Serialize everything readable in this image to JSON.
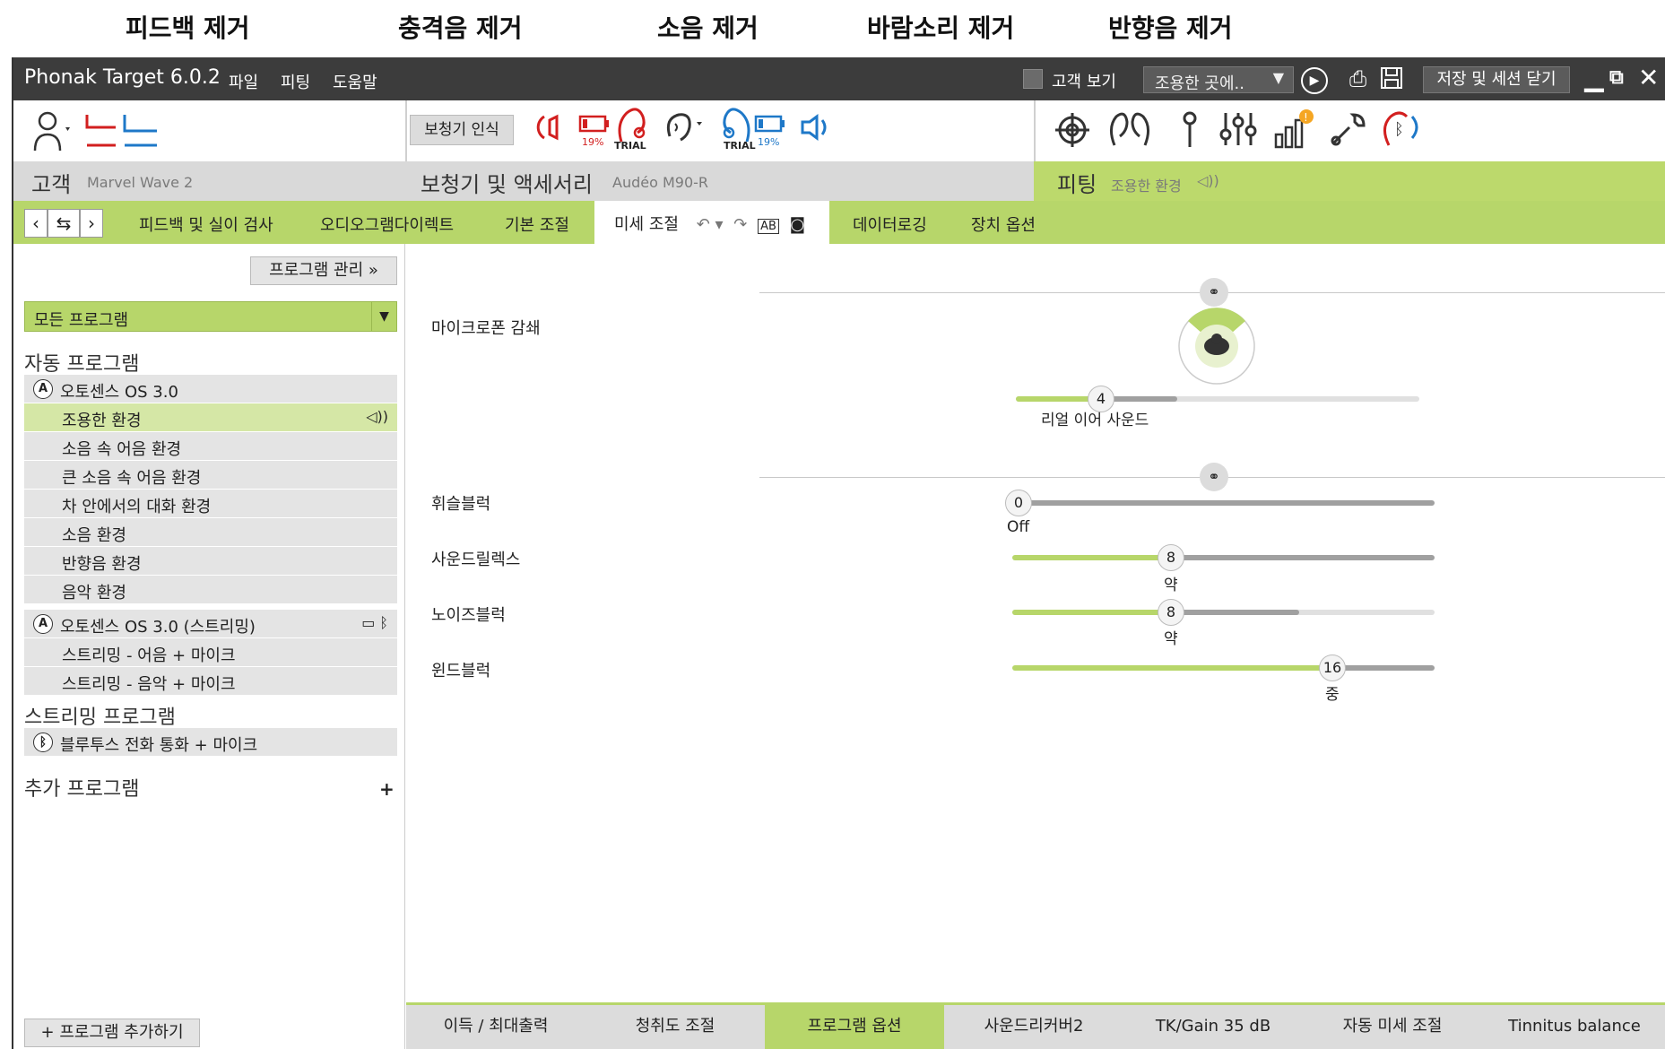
{
  "annotations": [
    "피드백 제거",
    "충격음 제거",
    "소음 제거",
    "바람소리 제거",
    "반향음 제거"
  ],
  "titlebar": {
    "app_title": "Phonak Target 6.0.2",
    "menus": [
      "파일",
      "피팅",
      "도움말"
    ],
    "client_view_label": "고객 보기",
    "environment_select": "조용한 곳에..",
    "save_close_label": "저장 및 세션 닫기"
  },
  "toolbar": {
    "recognize_label": "보청기 인식",
    "battery_left": "19%",
    "battery_right": "19%",
    "trial_left": "TRIAL",
    "trial_right": "TRIAL"
  },
  "sections": {
    "client_heading": "고객",
    "client_name": "Marvel Wave 2",
    "devices_heading": "보청기 및 액세서리",
    "device_model": "Audéo M90-R",
    "fitting_heading": "피팅",
    "fitting_sub": "조용한 환경"
  },
  "tabs": [
    "피드백 및 실이 검사",
    "오디오그램다이렉트",
    "기본 조절",
    "미세 조절",
    "데이터로깅",
    "장치 옵션"
  ],
  "tab_ab_label": "AB",
  "left_panel": {
    "program_manage": "프로그램 관리",
    "all_programs": "모든 프로그램",
    "auto_group": "자동 프로그램",
    "autosense_label": "오토센스 OS 3.0",
    "auto_items": [
      "조용한 환경",
      "소음 속 어음 환경",
      "큰 소음 속 어음 환경",
      "차 안에서의 대화 환경",
      "소음 환경",
      "반향음 환경",
      "음악 환경"
    ],
    "autosense_stream_label": "오토센스 OS 3.0 (스트리밍)",
    "stream_items": [
      "스트리밍 - 어음 + 마이크",
      "스트리밍 - 음악 + 마이크"
    ],
    "streaming_group": "스트리밍 프로그램",
    "bt_label": "블루투스 전화 통화 + 마이크",
    "extra_group": "추가 프로그램",
    "add_program": "프로그램 추가하기",
    "badge_letter": "A"
  },
  "main": {
    "mic_attenuation_label": "마이크로폰 감쇄",
    "real_ear_value": "4",
    "real_ear_label": "리얼 이어 사운드",
    "sliders": [
      {
        "label": "휘슬블럭",
        "value": "0",
        "sub": "Off"
      },
      {
        "label": "사운드릴렉스",
        "value": "8",
        "sub": "약"
      },
      {
        "label": "노이즈블럭",
        "value": "8",
        "sub": "약"
      },
      {
        "label": "윈드블럭",
        "value": "16",
        "sub": "중"
      }
    ]
  },
  "bottom_tabs": [
    "이득 / 최대출력",
    "청취도 조절",
    "프로그램 옵션",
    "사운드리커버2",
    "TK/Gain 35 dB",
    "자동 미세 조절",
    "Tinnitus balance"
  ],
  "colors": {
    "accent_green": "#b7d66a",
    "titlebar": "#3c3c3c",
    "red_device": "#d21f1f",
    "blue_device": "#1e78c8"
  }
}
